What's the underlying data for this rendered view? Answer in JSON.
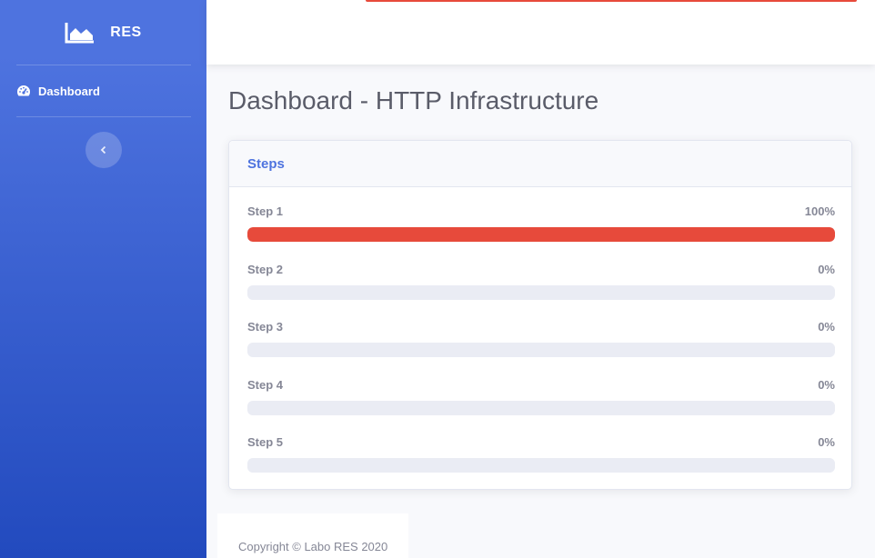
{
  "sidebar": {
    "brand": {
      "icon": "area-chart-icon",
      "text": "RES"
    },
    "items": [
      {
        "label": "Dashboard",
        "icon": "tachometer-icon"
      }
    ],
    "toggle_icon": "chevron-left-icon"
  },
  "topbar": {
    "accent_color": "#e74a3b"
  },
  "page": {
    "title": "Dashboard - HTTP Infrastructure"
  },
  "steps_card": {
    "title": "Steps",
    "steps": [
      {
        "label": "Step 1",
        "percent_text": "100%",
        "progress": 100
      },
      {
        "label": "Step 2",
        "percent_text": "0%",
        "progress": 0
      },
      {
        "label": "Step 3",
        "percent_text": "0%",
        "progress": 0
      },
      {
        "label": "Step 4",
        "percent_text": "0%",
        "progress": 0
      },
      {
        "label": "Step 5",
        "percent_text": "0%",
        "progress": 0
      }
    ]
  },
  "footer": {
    "copyright": "Copyright © Labo RES 2020"
  },
  "colors": {
    "primary": "#4e73df",
    "danger": "#e74a3b",
    "text": "#5a5c69",
    "muted": "#858796"
  }
}
